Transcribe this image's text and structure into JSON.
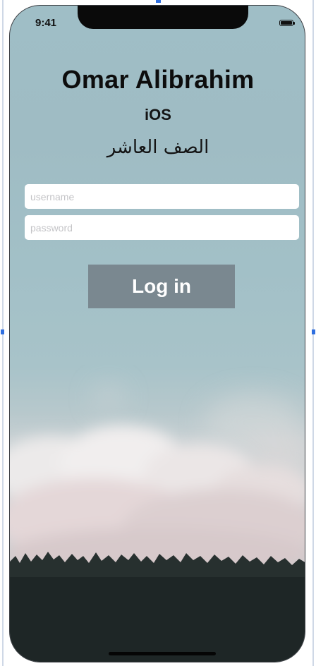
{
  "status_bar": {
    "time": "9:41",
    "battery_level": 1.0
  },
  "header": {
    "title": "Omar Alibrahim",
    "subtitle": "iOS",
    "arabic_label": "الصف العاشر"
  },
  "form": {
    "username_placeholder": "username",
    "username_value": "",
    "password_placeholder": "password",
    "password_value": ""
  },
  "actions": {
    "login_label": "Log in"
  },
  "colors": {
    "sky": "#9fbec6",
    "button": "#7a8890",
    "forest": "#1f2a2b"
  }
}
